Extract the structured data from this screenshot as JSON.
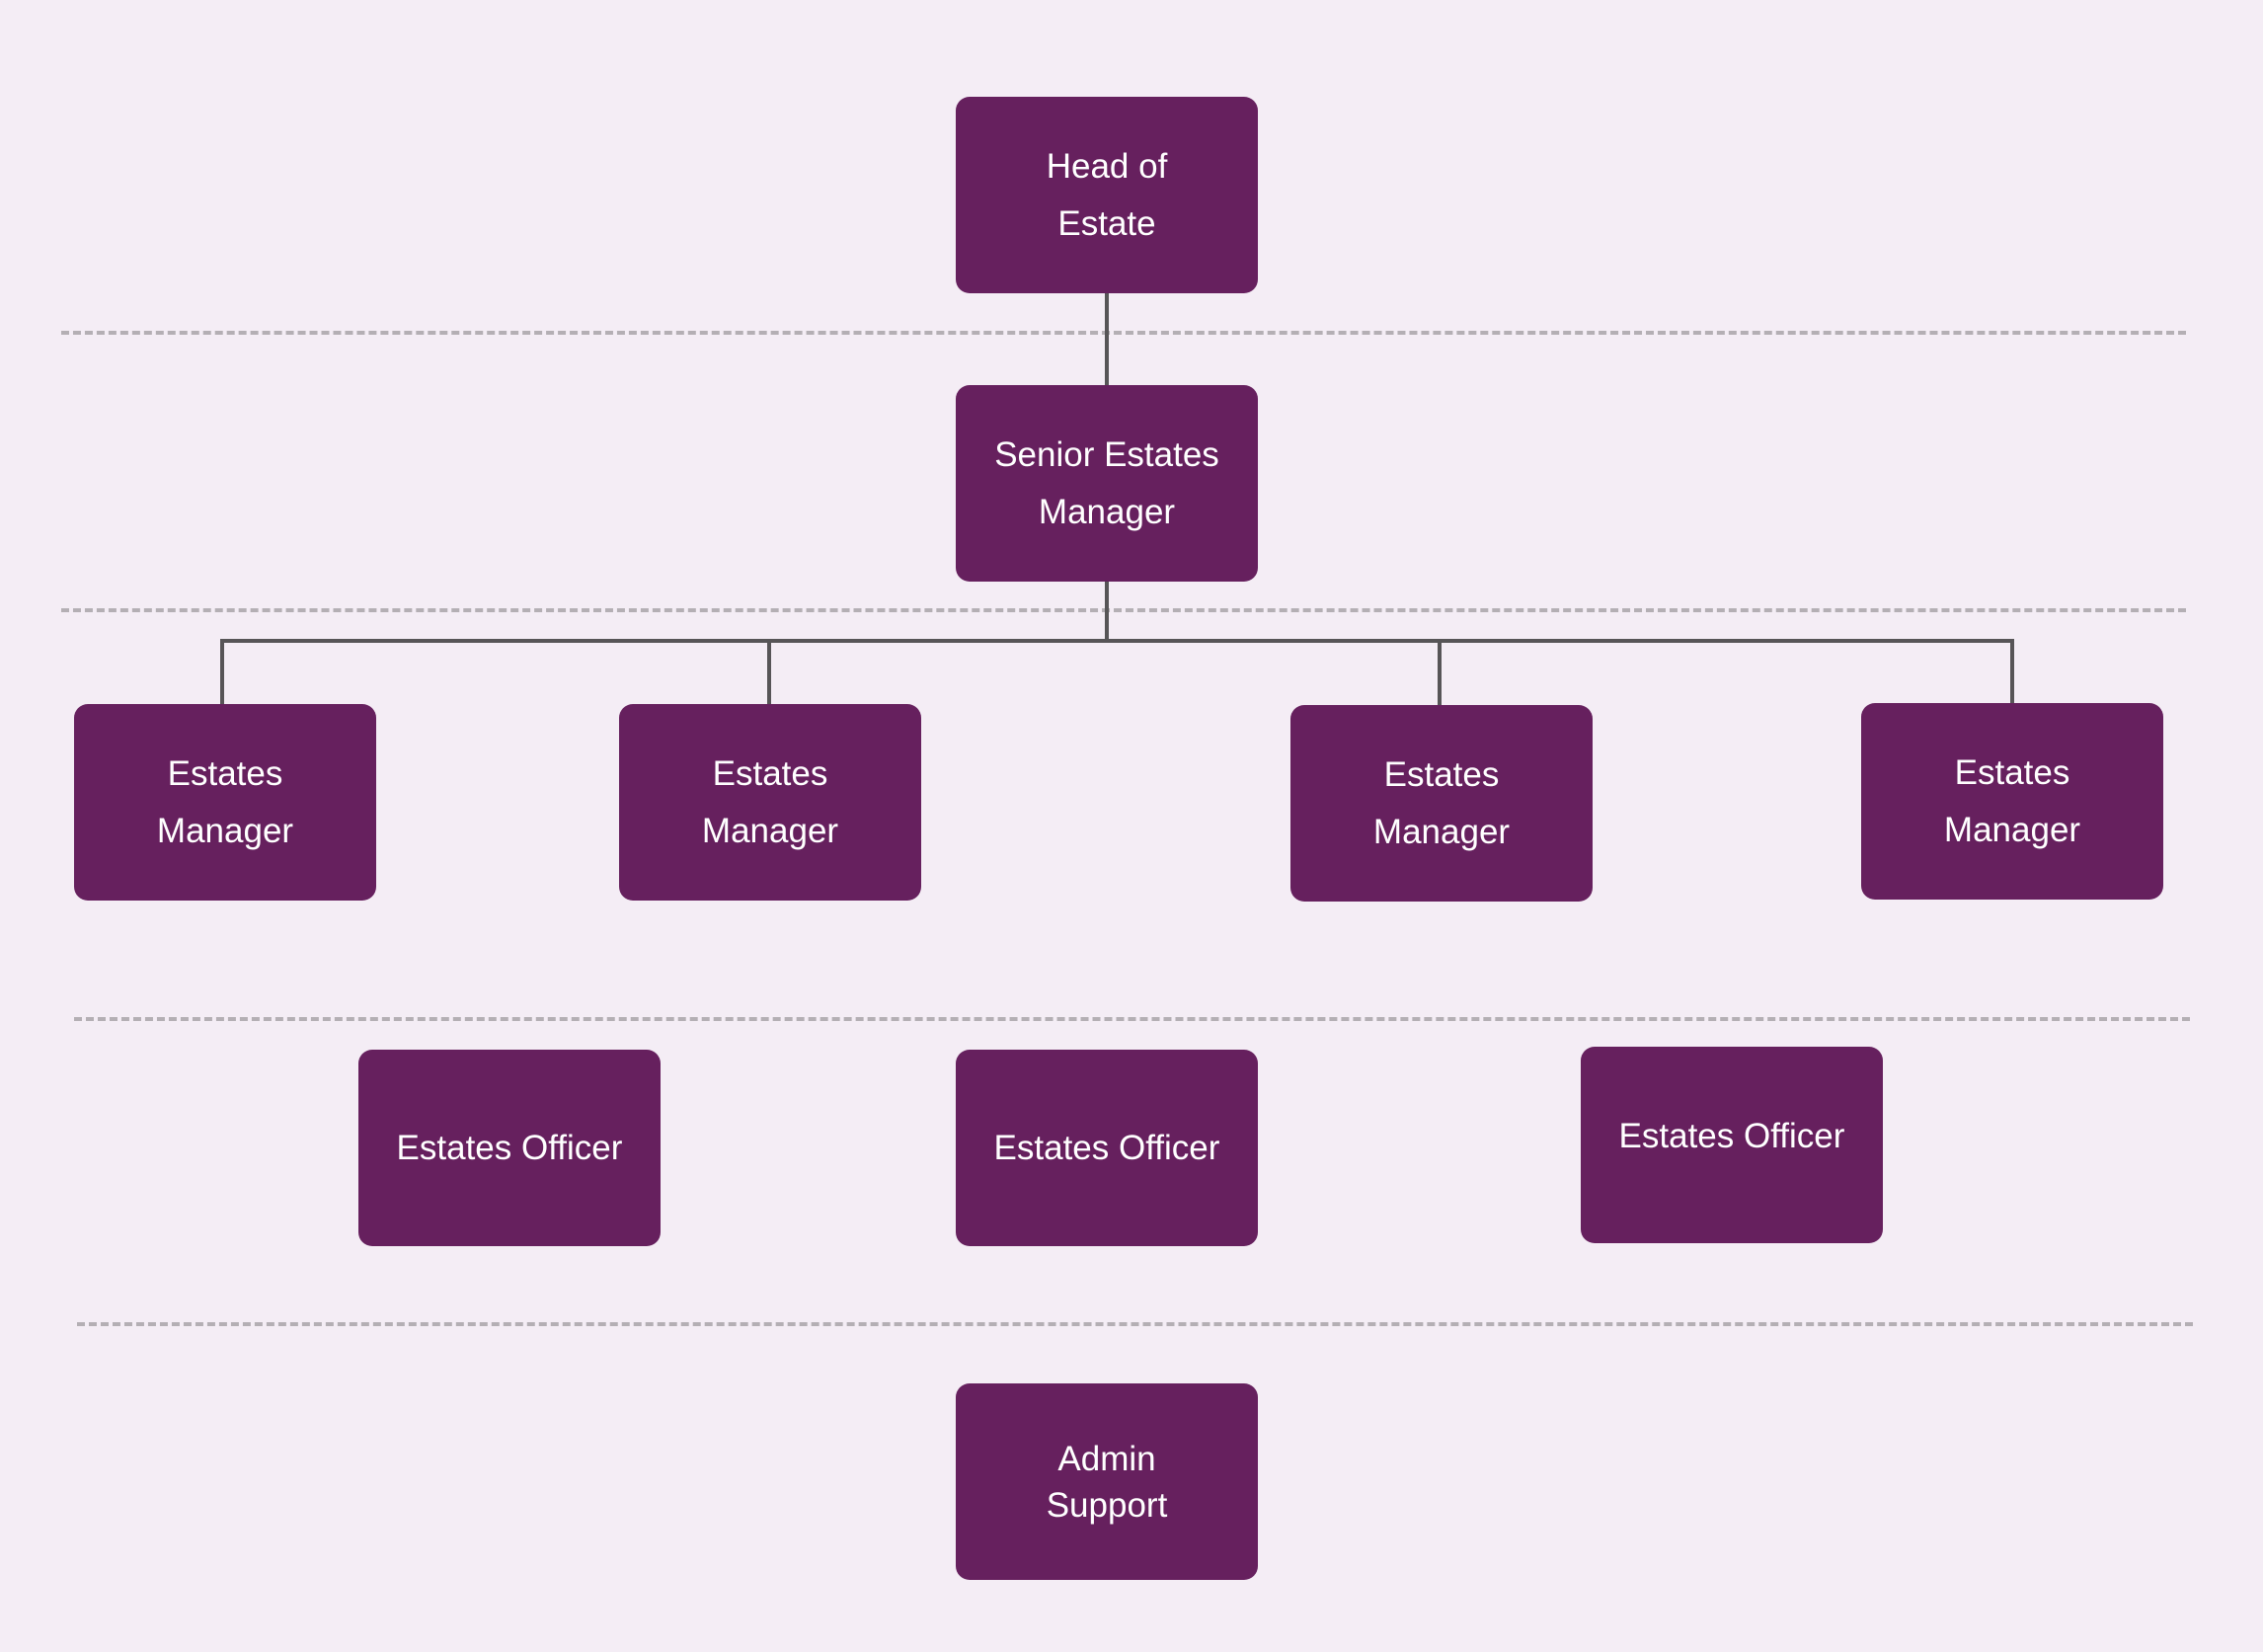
{
  "diagram": {
    "type": "org-chart",
    "colors": {
      "background": "#F4EDF5",
      "node_fill": "#66205E",
      "node_text": "#FFFFFF",
      "connector": "#575557",
      "tier_divider": "#B4AFB4"
    },
    "nodes": {
      "head": {
        "lines": [
          "Head of",
          "Estate"
        ]
      },
      "senior": {
        "lines": [
          "Senior Estates",
          "Manager"
        ]
      },
      "managers": [
        {
          "lines": [
            "Estates",
            "Manager"
          ]
        },
        {
          "lines": [
            "Estates",
            "Manager"
          ]
        },
        {
          "lines": [
            "Estates",
            "Manager"
          ]
        },
        {
          "lines": [
            "Estates",
            "Manager"
          ]
        }
      ],
      "officers": [
        {
          "lines": [
            "Estates Officer"
          ]
        },
        {
          "lines": [
            "Estates Officer"
          ]
        },
        {
          "lines": [
            "Estates Officer"
          ]
        }
      ],
      "admin": {
        "lines": [
          "Admin",
          "Support"
        ]
      }
    },
    "edges": [
      [
        "Head of Estate",
        "Senior Estates Manager"
      ],
      [
        "Senior Estates Manager",
        "Estates Manager 1"
      ],
      [
        "Senior Estates Manager",
        "Estates Manager 2"
      ],
      [
        "Senior Estates Manager",
        "Estates Manager 3"
      ],
      [
        "Senior Estates Manager",
        "Estates Manager 4"
      ]
    ]
  }
}
